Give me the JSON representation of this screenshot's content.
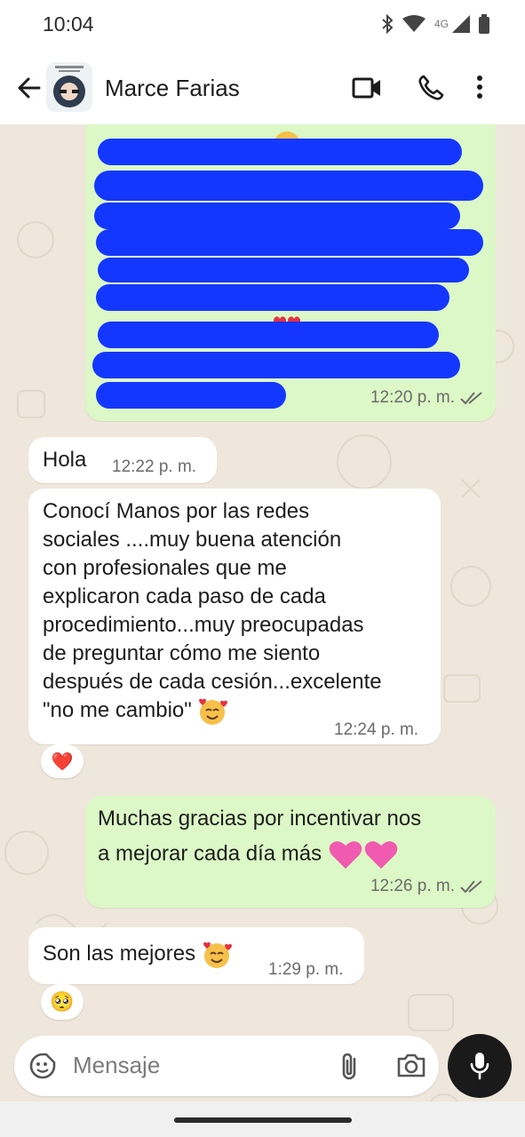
{
  "status_bar": {
    "time": "10:04",
    "network": "4G"
  },
  "header": {
    "contact_name": "Marce Farias"
  },
  "messages": [
    {
      "direction": "outgoing",
      "text": "",
      "time": "12:20 p. m.",
      "status": "read"
    },
    {
      "direction": "incoming",
      "text": "Hola",
      "time": "12:22 p. m."
    },
    {
      "direction": "incoming",
      "lines": [
        "Conocí Manos por las redes",
        "sociales ....muy buena atención",
        "con profesionales que me",
        "explicaron cada paso de cada",
        "procedimiento...muy preocupadas",
        "de preguntar cómo me siento",
        "después de cada cesión...excelente",
        "\"no me cambio\""
      ],
      "time": "12:24 p. m.",
      "reaction": "❤️"
    },
    {
      "direction": "outgoing",
      "lines": [
        "Muchas gracias  por incentivar nos",
        "a mejorar cada día más "
      ],
      "time": "12:26 p. m.",
      "status": "read"
    },
    {
      "direction": "incoming",
      "text": "Son las mejores",
      "time": "1:29 p. m.",
      "reaction": "🥺"
    }
  ],
  "input": {
    "placeholder": "Mensaje"
  },
  "colors": {
    "outgoing": "#dcf8c6",
    "incoming": "#ffffff",
    "background": "#efe7dc",
    "redaction": "#1437ff"
  }
}
